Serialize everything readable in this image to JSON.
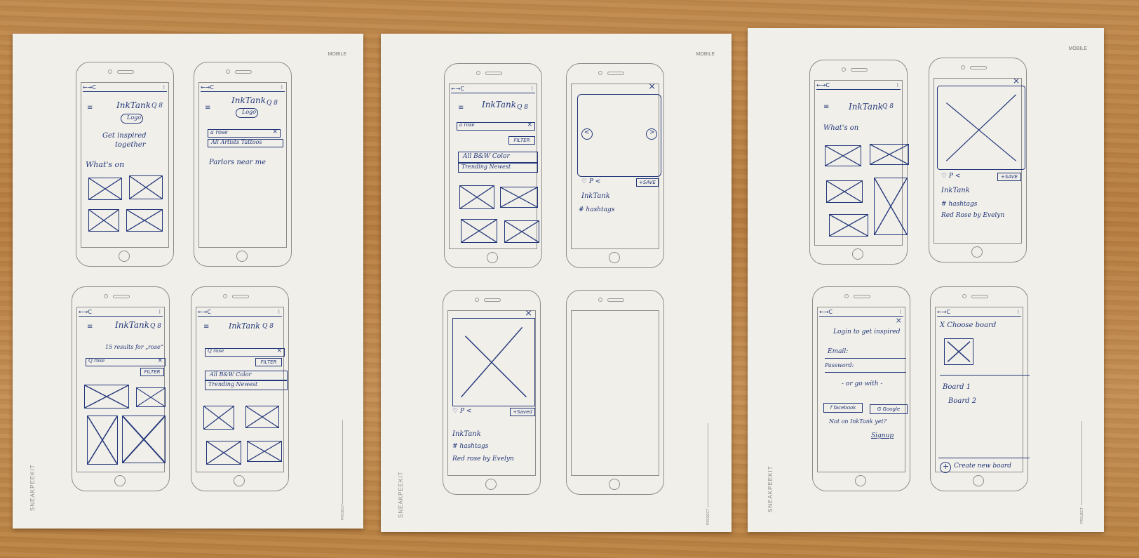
{
  "sheets": [
    {
      "brand": "SNEAKPEEKIT",
      "label": "MOBILE",
      "project": "PROJECT"
    },
    {
      "brand": "SNEAKPEEKIT",
      "label": "MOBILE",
      "project": "PROJECT"
    },
    {
      "brand": "SNEAKPEEKIT",
      "label": "MOBILE",
      "project": "PROJECT"
    }
  ],
  "common": {
    "nav": "←→C",
    "dots": "⁝",
    "logo_text": "InkTank",
    "search_glyph": "Q 8",
    "menu_glyph": "≡",
    "close_glyph": "×"
  },
  "screen_home": {
    "logo_pill": "Logo",
    "tagline_1": "Get inspired",
    "tagline_2": "together",
    "section": "What's on"
  },
  "screen_search_results": {
    "logo_pill": "Logo",
    "query": "a rose",
    "tabs": "All  Artists  Tattoos",
    "parlors": "Parlors near me"
  },
  "screen_results_count": {
    "heading": "15 results for „rose“",
    "query": "Q rose",
    "filter": "FILTER"
  },
  "screen_filter_open": {
    "query": "Q rose",
    "filter": "FILTER",
    "row1": "All   B&W   Color",
    "row2": "Trending   Newest"
  },
  "screen_filter_mid": {
    "query": "a rose",
    "filter": "FILTER",
    "row1": "All   B&W   Color",
    "row2": "Trending   Newest"
  },
  "screen_detail_carousel": {
    "left": "<",
    "right": ">",
    "save": "+SAVE",
    "actions": "♡ P <",
    "brand": "InkTank",
    "hashtags": "# hashtags"
  },
  "screen_detail_saved": {
    "save": "+Saved",
    "actions": "♡ P <",
    "brand": "InkTank",
    "hashtags": "# hashtags",
    "credit": "Red rose by Evelyn"
  },
  "screen_whatson": {
    "section": "What's on"
  },
  "screen_detail_full": {
    "save": "+SAVE",
    "actions": "♡ P <",
    "brand": "InkTank",
    "hashtags": "# hashtags",
    "credit": "Red Rose by Evelyn"
  },
  "screen_login": {
    "title": "Login to get inspired",
    "email": "Email:",
    "password": "Password:",
    "or": "- or go with -",
    "facebook": "f facebook",
    "google": "G Google",
    "not_on": "Not on InkTank yet?",
    "signup": "Signup"
  },
  "screen_board": {
    "title": "X  Choose board",
    "board1": "Board 1",
    "board2": "Board 2",
    "create": "Create new board"
  }
}
